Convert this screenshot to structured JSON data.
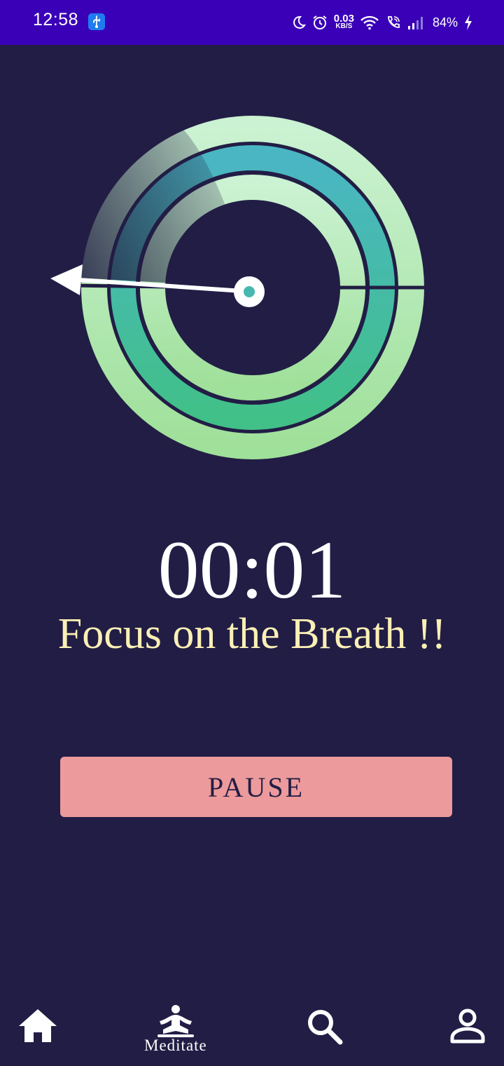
{
  "status_bar": {
    "time": "12:58",
    "net_speed_value": "0.03",
    "net_speed_unit": "KB/S",
    "battery": "84%"
  },
  "timer": {
    "elapsed": "00:01"
  },
  "prompt": {
    "text": "Focus on the Breath !!"
  },
  "controls": {
    "pause_label": "PAUSE"
  },
  "bottom_nav": {
    "items": [
      {
        "icon": "home-icon",
        "label": ""
      },
      {
        "icon": "meditate-icon",
        "label": "Meditate"
      },
      {
        "icon": "search-icon",
        "label": ""
      },
      {
        "icon": "profile-icon",
        "label": ""
      }
    ],
    "active": "Meditate"
  },
  "colors": {
    "background": "#221d45",
    "status_bar": "#3a00b8",
    "prompt_text": "#fbf0b5",
    "pause_button": "#ec9a9b",
    "ring_light": "#a8e6a8",
    "ring_teal": "#46b8b0"
  }
}
